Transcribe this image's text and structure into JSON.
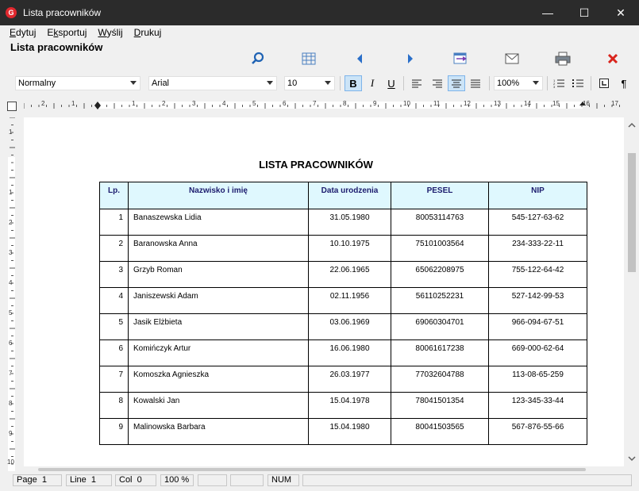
{
  "window": {
    "app_icon_letter": "G",
    "title": "Lista pracowników",
    "controls": {
      "minimize": "—",
      "maximize": "☐",
      "close": "✕"
    }
  },
  "menu": {
    "items": [
      {
        "label": "Edytuj"
      },
      {
        "label": "Eksportuj"
      },
      {
        "label": "Wyślij"
      },
      {
        "label": "Drukuj"
      }
    ]
  },
  "header": {
    "caption": "Lista pracowników",
    "icons": [
      "search-icon",
      "table-icon",
      "arrow-left-icon",
      "arrow-right-icon",
      "export-icon",
      "mail-icon",
      "print-icon",
      "close-icon"
    ]
  },
  "format": {
    "style": "Normalny",
    "font": "Arial",
    "size": "10",
    "zoom": "100%",
    "bold": "B",
    "italic": "I",
    "underline": "U",
    "pilcrow": "¶"
  },
  "ruler": {
    "h_numbers": [
      "2",
      "1",
      "1",
      "2",
      "3",
      "4",
      "5",
      "6",
      "7",
      "8",
      "9",
      "10",
      "11",
      "12",
      "13",
      "14",
      "15",
      "16",
      "17"
    ],
    "v_numbers": [
      "1",
      "1",
      "2",
      "3",
      "4",
      "5",
      "6",
      "7",
      "8",
      "9",
      "10"
    ]
  },
  "document": {
    "title": "LISTA PRACOWNIKÓW",
    "columns": [
      "Lp.",
      "Nazwisko i imię",
      "Data urodzenia",
      "PESEL",
      "NIP"
    ],
    "rows": [
      {
        "lp": "1",
        "name": "Banaszewska Lidia",
        "date": "31.05.1980",
        "pesel": "80053114763",
        "nip": "545-127-63-62"
      },
      {
        "lp": "2",
        "name": "Baranowska Anna",
        "date": "10.10.1975",
        "pesel": "75101003564",
        "nip": "234-333-22-11"
      },
      {
        "lp": "3",
        "name": "Grzyb Roman",
        "date": "22.06.1965",
        "pesel": "65062208975",
        "nip": "755-122-64-42"
      },
      {
        "lp": "4",
        "name": "Janiszewski Adam",
        "date": "02.11.1956",
        "pesel": "56110252231",
        "nip": "527-142-99-53"
      },
      {
        "lp": "5",
        "name": "Jasik Elżbieta",
        "date": "03.06.1969",
        "pesel": "69060304701",
        "nip": "966-094-67-51"
      },
      {
        "lp": "6",
        "name": "Komińczyk Artur",
        "date": "16.06.1980",
        "pesel": "80061617238",
        "nip": "669-000-62-64"
      },
      {
        "lp": "7",
        "name": "Komoszka Agnieszka",
        "date": "26.03.1977",
        "pesel": "77032604788",
        "nip": "113-08-65-259"
      },
      {
        "lp": "8",
        "name": "Kowalski Jan",
        "date": "15.04.1978",
        "pesel": "78041501354",
        "nip": "123-345-33-44"
      },
      {
        "lp": "9",
        "name": "Malinowska Barbara",
        "date": "15.04.1980",
        "pesel": "80041503565",
        "nip": "567-876-55-66"
      }
    ]
  },
  "status": {
    "page_label": "Page",
    "page_value": "1",
    "line_label": "Line",
    "line_value": "1",
    "col_label": "Col",
    "col_value": "0",
    "zoom": "100 %",
    "num": "NUM"
  }
}
